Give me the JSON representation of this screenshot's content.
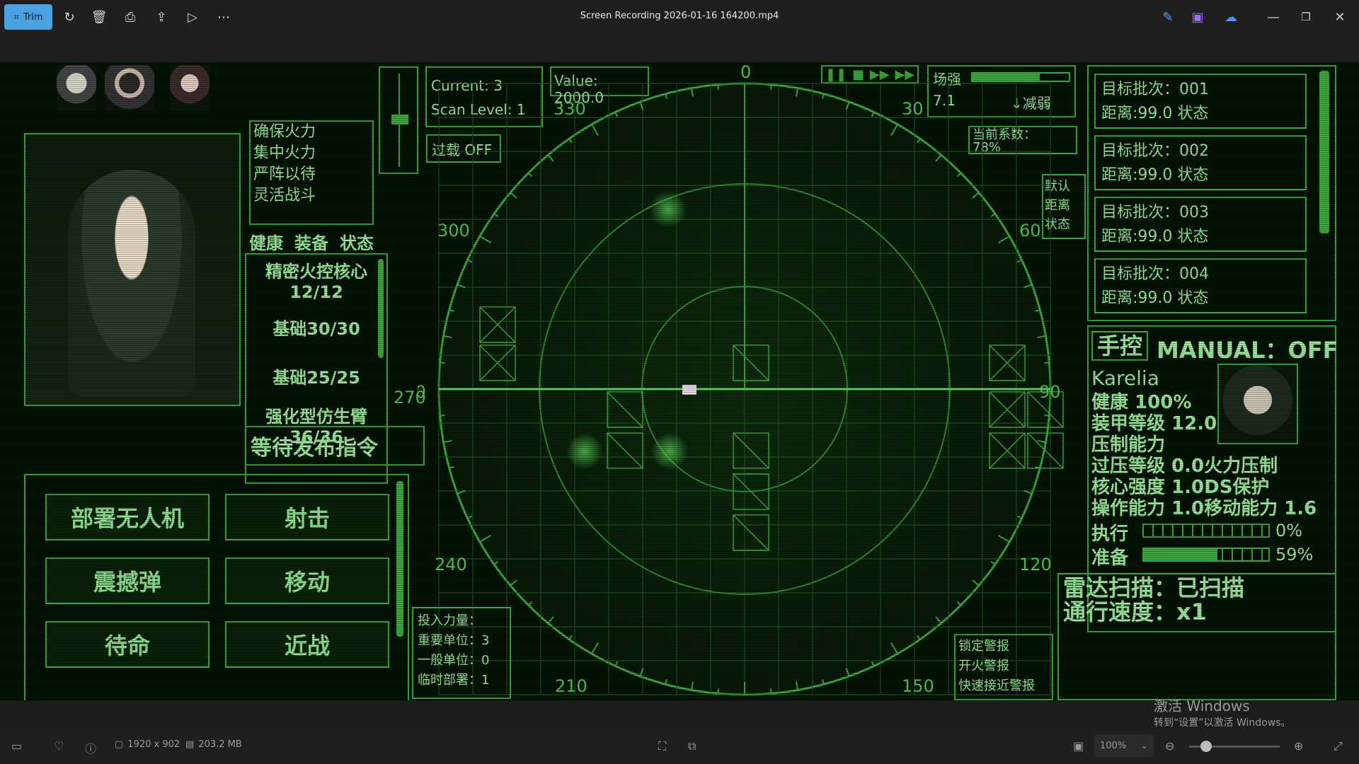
{
  "toolbar": {
    "trim_label": "Trim",
    "window_title": "Screen Recording 2026-01-16 164200.mp4"
  },
  "status_bar": {
    "dimensions": "1920 x 902",
    "file_size": "203.2 MB",
    "zoom": "100%"
  },
  "watermark": {
    "line1": "激活 Windows",
    "line2": "转到“设置”以激活 Windows。"
  },
  "game": {
    "fire_modes": [
      "确保火力",
      "集中火力",
      "严阵以待",
      "灵活战斗"
    ],
    "tabs": [
      "健康",
      "装备",
      "状态"
    ],
    "equipment": [
      {
        "name": "精密火控核心",
        "value": "12/12"
      },
      {
        "name": "基础30/30",
        "value": ""
      },
      {
        "name": "基础25/25",
        "value": ""
      },
      {
        "name": "强化型仿生臂",
        "value": "36/36"
      }
    ],
    "command_status": "等待发布指令",
    "actions": [
      "部署无人机",
      "射击",
      "震撼弹",
      "移动",
      "待命",
      "近战"
    ],
    "current": "Current: 3",
    "scan_level": "Scan Level: 1",
    "value": "Value: 2000.0",
    "overload": "过载 OFF",
    "field_label": "场强",
    "field_value": "7.1",
    "field_trend": "↓减弱",
    "field_fill_fraction": 0.7,
    "coefficient_label": "当前系数：",
    "coefficient_value": "78%",
    "side_tabs": [
      "默认",
      "距离",
      "状态"
    ],
    "compass": {
      "n": "0",
      "deg30": "30",
      "deg60": "60",
      "e": "90",
      "deg120": "120",
      "deg150": "150",
      "deg210": "210",
      "deg240": "240",
      "w": "270",
      "deg300": "300",
      "deg330": "330"
    },
    "targets": [
      {
        "batch": "目标批次：001",
        "info": "距离:99.0 状态"
      },
      {
        "batch": "目标批次：002",
        "info": "距离:99.0 状态"
      },
      {
        "batch": "目标批次：003",
        "info": "距离:99.0 状态"
      },
      {
        "batch": "目标批次：004",
        "info": "距离:99.0 状态"
      }
    ],
    "manual_label": "手控",
    "manual_status": "MANUAL：OFF",
    "unit": {
      "name": "Karelia",
      "health": "健康 100%",
      "armor": "装甲等级 12.0",
      "suppress": "压制能力",
      "overpressure": "过压等级 0.0火力压制",
      "core": "核心强度 1.0DS保护",
      "ops": "操作能力 1.0移动能力 1.6",
      "exec_label": "执行",
      "exec_value": "0%",
      "exec_fraction": 0.0,
      "ready_label": "准备",
      "ready_value": "59%",
      "ready_fraction": 0.59
    },
    "radar_scan": "雷达扫描：已扫描",
    "pass_speed": "通行速度：x1",
    "force": {
      "title": "投入力量：",
      "important": "重要单位：3",
      "general": "一般单位：0",
      "temp": "临时部署：1"
    },
    "alerts": [
      "锁定警报",
      "开火警报",
      "快速接近警报"
    ]
  }
}
